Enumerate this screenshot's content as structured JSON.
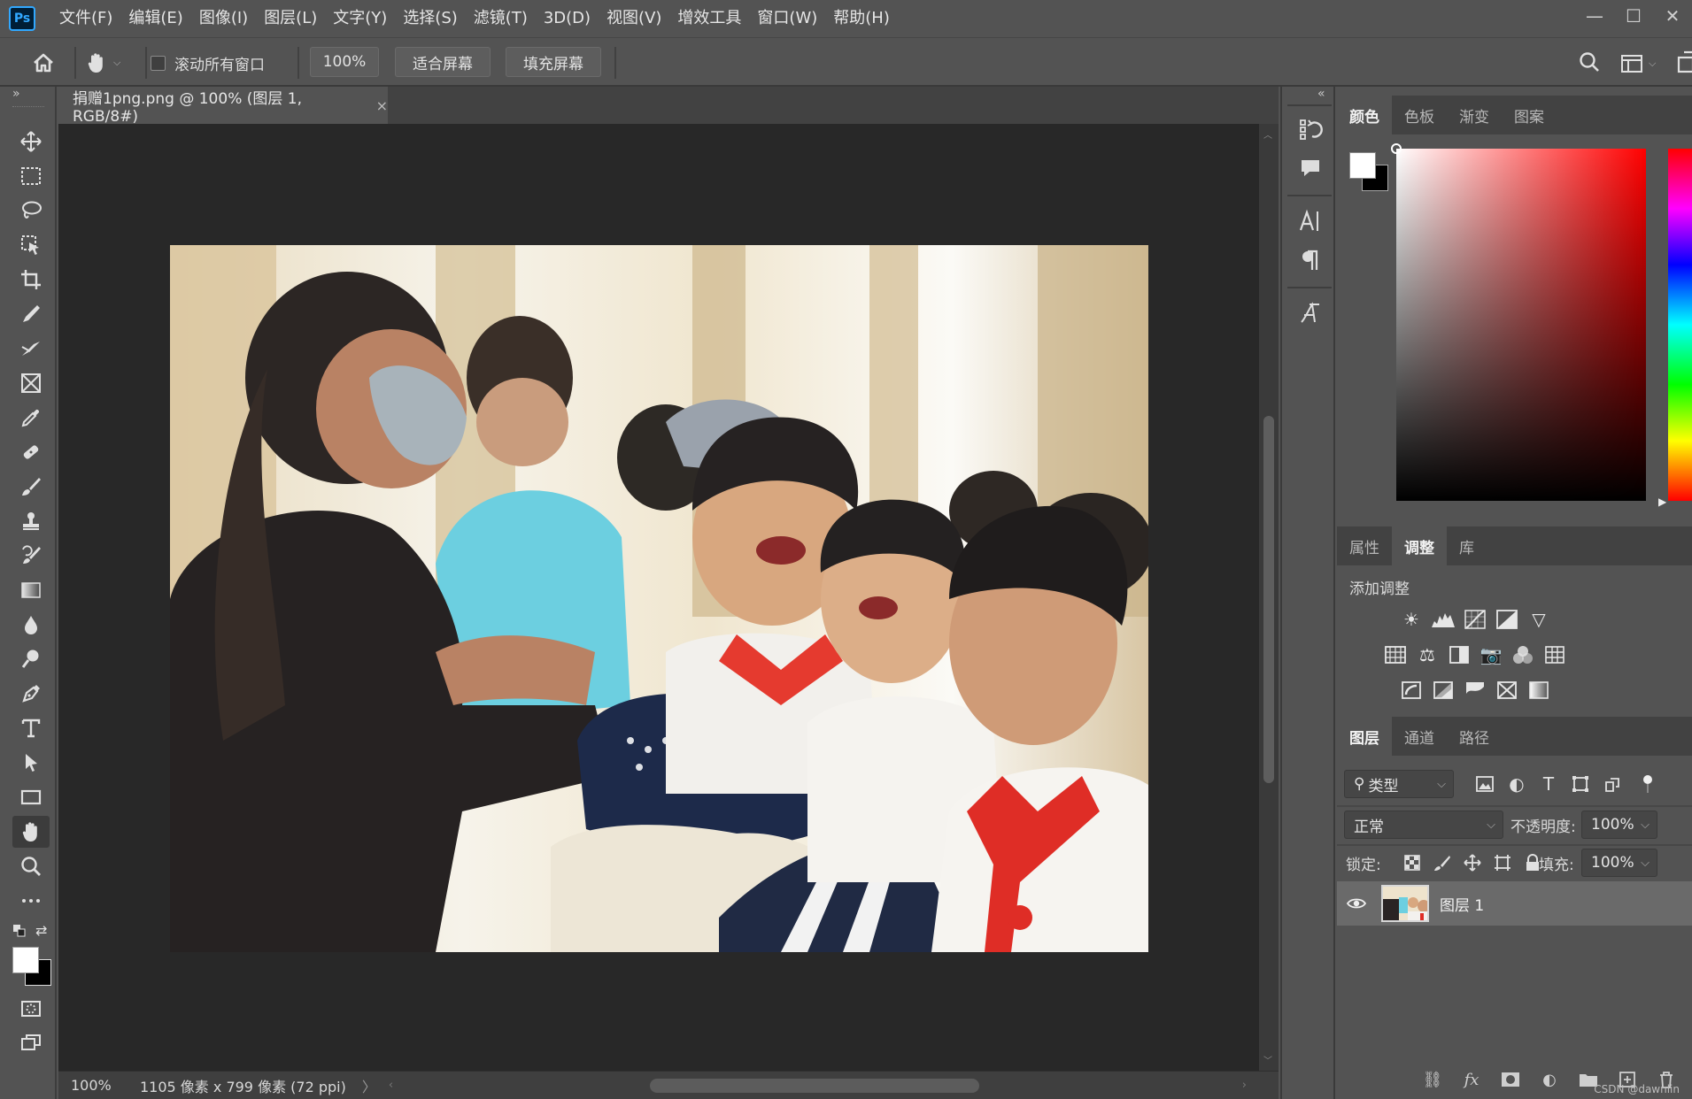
{
  "app": {
    "logo": "Ps",
    "menu": [
      "文件(F)",
      "编辑(E)",
      "图像(I)",
      "图层(L)",
      "文字(Y)",
      "选择(S)",
      "滤镜(T)",
      "3D(D)",
      "视图(V)",
      "增效工具",
      "窗口(W)",
      "帮助(H)"
    ],
    "window_controls": [
      "—",
      "☐",
      "✕"
    ]
  },
  "options_bar": {
    "scroll_all_label": "滚动所有窗口",
    "zoom_value": "100%",
    "fit_screen": "适合屏幕",
    "fill_screen": "填充屏幕"
  },
  "document": {
    "tab_title": "捐赠1png.png @ 100% (图层 1, RGB/8#)",
    "tab_close": "×"
  },
  "status_bar": {
    "zoom": "100%",
    "info": "1105 像素 x 799 像素 (72 ppi)",
    "arrow": "〉"
  },
  "color_panel": {
    "tabs": [
      "颜色",
      "色板",
      "渐变",
      "图案"
    ],
    "active_tab": "颜色",
    "foreground": "#ffffff",
    "background": "#000000",
    "hue_base": "#ff0000"
  },
  "adjust_panel": {
    "tabs": [
      "属性",
      "调整",
      "库"
    ],
    "active_tab": "调整",
    "add_label": "添加调整"
  },
  "layers_panel": {
    "tabs": [
      "图层",
      "通道",
      "路径"
    ],
    "active_tab": "图层",
    "filter_kind": "类型",
    "blend_mode": "正常",
    "opacity_label": "不透明度:",
    "opacity_value": "100%",
    "lock_label": "锁定:",
    "fill_label": "填充:",
    "fill_value": "100%",
    "layers": [
      {
        "name": "图层 1",
        "visible": true
      }
    ]
  },
  "watermark": "CSDN @dawnlin"
}
